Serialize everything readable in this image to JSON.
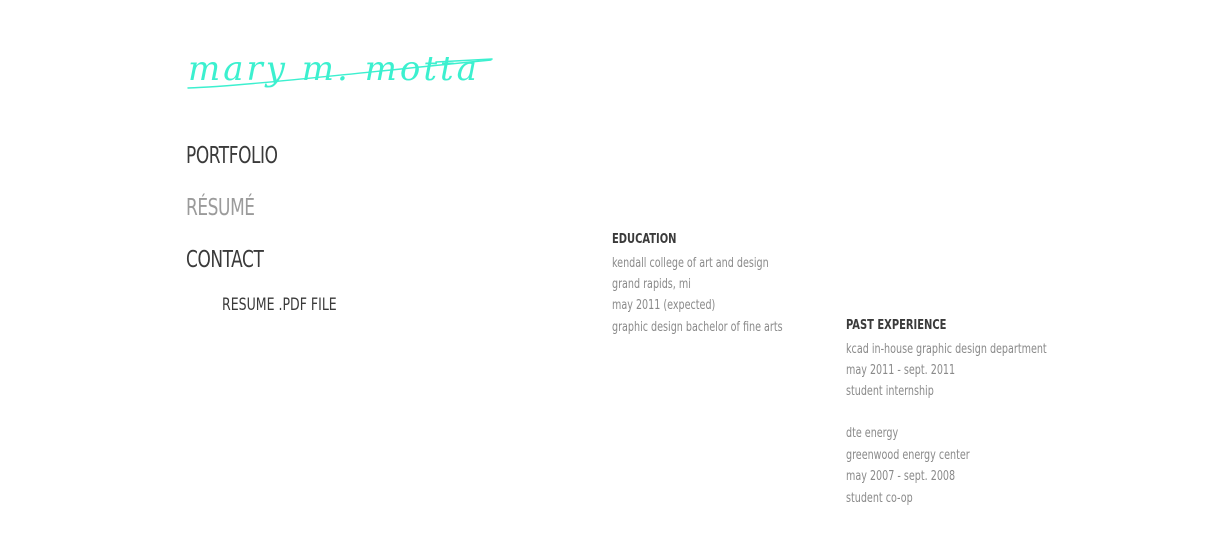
{
  "header": {
    "logo_text": "mary m. motta",
    "logo_color": "#3cf0cf"
  },
  "nav": {
    "portfolio": "PORTFOLIO",
    "resume": "RÉSUMÉ",
    "contact": "CONTACT",
    "resume_pdf": "RESUME .PDF FILE"
  },
  "education": {
    "title": "EDUCATION",
    "lines": [
      "kendall college of art and design",
      "grand rapids, mi",
      "may 2011 (expected)",
      "graphic design bachelor of fine arts"
    ]
  },
  "experience": {
    "title": "PAST EXPERIENCE",
    "lines": [
      "kcad in-house graphic design department",
      "may 2011 - sept. 2011",
      "student internship",
      "",
      "dte energy",
      "greenwood energy center",
      "may 2007 - sept. 2008",
      "student co-op"
    ]
  },
  "colors": {
    "text_dark": "#3a3a3a",
    "text_muted": "#8a8a8a",
    "nav_active": "#9b9b9b",
    "accent": "#3cf0cf"
  }
}
